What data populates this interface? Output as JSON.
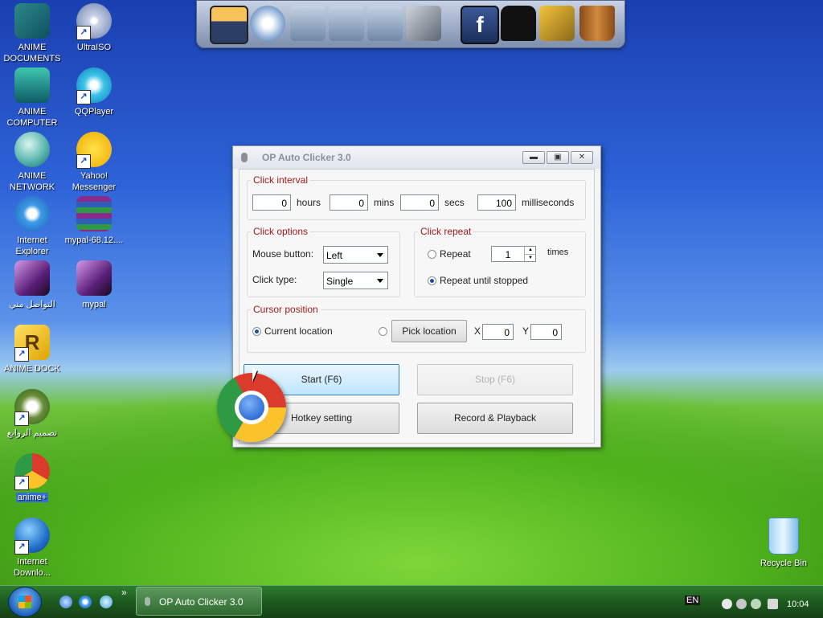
{
  "desktop": {
    "icons": [
      {
        "label": "ANIME DOCUMENTS"
      },
      {
        "label": "UltraISO"
      },
      {
        "label": "ANIME COMPUTER"
      },
      {
        "label": "QQPlayer"
      },
      {
        "label": "ANIME NETWORK"
      },
      {
        "label": "Yahoo! Messenger"
      },
      {
        "label": "Internet Explorer"
      },
      {
        "label": "mypal-68.12...."
      },
      {
        "label": "التواصل مني"
      },
      {
        "label": "mypal"
      },
      {
        "label": "ANIME DOCK"
      },
      {
        "label": "تصميم الروابع"
      },
      {
        "label": "anime+"
      },
      {
        "label": "Internet Downlo..."
      },
      {
        "label": "Recycle Bin"
      }
    ]
  },
  "dock": {
    "items": [
      "naruto-icon",
      "globe-docs-icon",
      "folder-icon",
      "folder-icon",
      "folder-icon",
      "tools-icon",
      "facebook-icon",
      "tshirt-icon",
      "hammer-icon",
      "bucket-icon"
    ]
  },
  "window": {
    "title": "OP Auto Clicker 3.0",
    "click_interval": {
      "label": "Click interval",
      "hours_value": "0",
      "hours_label": "hours",
      "mins_value": "0",
      "mins_label": "mins",
      "secs_value": "0",
      "secs_label": "secs",
      "ms_value": "100",
      "ms_label": "milliseconds"
    },
    "click_options": {
      "label": "Click options",
      "mouse_button_label": "Mouse button:",
      "mouse_button_value": "Left",
      "click_type_label": "Click type:",
      "click_type_value": "Single"
    },
    "click_repeat": {
      "label": "Click repeat",
      "repeat_label": "Repeat",
      "repeat_value": "1",
      "times_label": "times",
      "until_stopped_label": "Repeat until stopped"
    },
    "cursor_position": {
      "label": "Cursor position",
      "current_location_label": "Current location",
      "pick_location_label": "Pick location",
      "x_label": "X",
      "x_value": "0",
      "y_label": "Y",
      "y_value": "0"
    },
    "buttons": {
      "start": "Start (F6)",
      "stop": "Stop (F6)",
      "hotkey": "Hotkey setting",
      "record": "Record & Playback"
    }
  },
  "taskbar": {
    "task_label": "OP Auto Clicker 3.0",
    "expand": "»",
    "language": "EN",
    "clock": "10:04"
  },
  "colors": {
    "group_label": "#a01a1a",
    "taskbar": "#1d5a1e"
  }
}
